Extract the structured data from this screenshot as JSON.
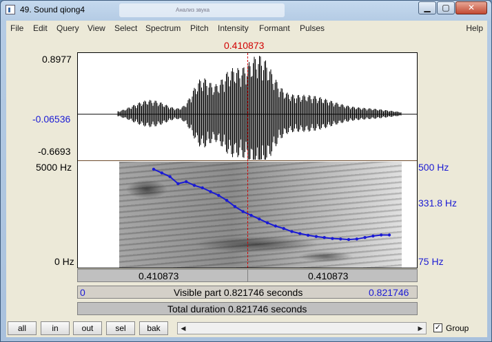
{
  "window": {
    "title": "49. Sound qiong4",
    "background_tab_text": "Анализ звука"
  },
  "menu": [
    "File",
    "Edit",
    "Query",
    "View",
    "Select",
    "Spectrum",
    "Pitch",
    "Intensity",
    "Formant",
    "Pulses"
  ],
  "help": "Help",
  "cursor_time": "0.410873",
  "waveform": {
    "max": "0.8977",
    "value": "-0.06536",
    "min": "-0.6693"
  },
  "spectrogram": {
    "max_freq": "5000 Hz",
    "min_freq": "0 Hz",
    "pitch_max": "500 Hz",
    "pitch_value": "331.8 Hz",
    "pitch_min": "75 Hz",
    "pitch_contour_hz": [
      470,
      455,
      440,
      412,
      420,
      405,
      395,
      380,
      365,
      345,
      320,
      300,
      285,
      270,
      255,
      242,
      232,
      220,
      212,
      205,
      200,
      196,
      192,
      190,
      188,
      190,
      196,
      202,
      206,
      206
    ]
  },
  "bars": {
    "left_time": "0.410873",
    "right_time": "0.410873",
    "visible_start": "0",
    "visible_text": "Visible part 0.821746 seconds",
    "visible_end": "0.821746",
    "total_text": "Total duration 0.821746 seconds"
  },
  "buttons": [
    "all",
    "in",
    "out",
    "sel",
    "bak"
  ],
  "group_label": "Group",
  "group_checked": "✓",
  "colors": {
    "cursor": "#d20000",
    "pitch": "#1a1ad4",
    "wave": "#000000"
  }
}
